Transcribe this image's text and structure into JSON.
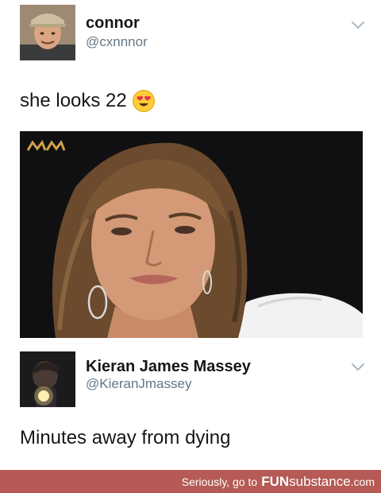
{
  "tweets": [
    {
      "display_name": "connor",
      "handle": "@cxnnnor",
      "text": "she looks 22",
      "emoji_icon": "heart-eyes-emoji-icon"
    },
    {
      "display_name": "Kieran James Massey",
      "handle": "@KieranJmassey",
      "text": "Minutes away from dying"
    }
  ],
  "footer": {
    "prefix": "Seriously, go to ",
    "brand_bold": "FUN",
    "brand_rest": "substance",
    "tld": ".com"
  },
  "colors": {
    "footer_bg": "#b55a55",
    "handle": "#657786",
    "text": "#14171a"
  }
}
